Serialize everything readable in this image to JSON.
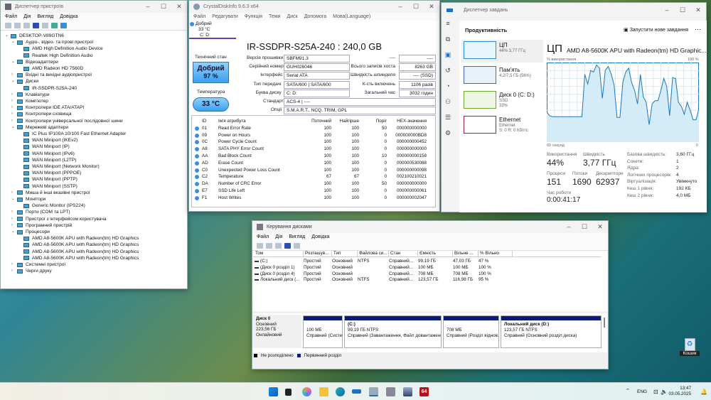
{
  "device_manager": {
    "title": "Диспетчер пристроїв",
    "menu": [
      "Файл",
      "Дія",
      "Вигляд",
      "Довідка"
    ],
    "tree": [
      {
        "l": 0,
        "t": "DESKTOP-V89GTN6",
        "e": "v"
      },
      {
        "l": 1,
        "t": "Аудіо-, відео- та ігрові пристрої",
        "e": "v"
      },
      {
        "l": 2,
        "t": "AMD High Definition Audio Device"
      },
      {
        "l": 2,
        "t": "Realtek High Definition Audio"
      },
      {
        "l": 1,
        "t": "Відеоадаптери",
        "e": "v"
      },
      {
        "l": 2,
        "t": "AMD Radeon HD 7560D"
      },
      {
        "l": 1,
        "t": "Вхідні та вихідні аудіопристрої",
        "e": ">"
      },
      {
        "l": 1,
        "t": "Диски",
        "e": "v"
      },
      {
        "l": 2,
        "t": "IR-SSDPR-S25A-240"
      },
      {
        "l": 1,
        "t": "Клавіатури",
        "e": ">"
      },
      {
        "l": 1,
        "t": "Комп'ютер",
        "e": ">"
      },
      {
        "l": 1,
        "t": "Контролери IDE ATA/ATAPI",
        "e": ">"
      },
      {
        "l": 1,
        "t": "Контролери сховища",
        "e": ">"
      },
      {
        "l": 1,
        "t": "Контролери універсальної послідовної шини",
        "e": ">"
      },
      {
        "l": 1,
        "t": "Мережеві адаптери",
        "e": "v"
      },
      {
        "l": 2,
        "t": "IC Plus IP100A 10/100 Fast Ethernet Adapter"
      },
      {
        "l": 2,
        "t": "WAN Miniport (IKEv2)"
      },
      {
        "l": 2,
        "t": "WAN Miniport (IP)"
      },
      {
        "l": 2,
        "t": "WAN Miniport (IPv6)"
      },
      {
        "l": 2,
        "t": "WAN Miniport (L2TP)"
      },
      {
        "l": 2,
        "t": "WAN Miniport (Network Monitor)"
      },
      {
        "l": 2,
        "t": "WAN Miniport (PPPOE)"
      },
      {
        "l": 2,
        "t": "WAN Miniport (PPTP)"
      },
      {
        "l": 2,
        "t": "WAN Miniport (SSTP)"
      },
      {
        "l": 1,
        "t": "Миша й інші вказівні пристрої",
        "e": ">"
      },
      {
        "l": 1,
        "t": "Монітори",
        "e": "v"
      },
      {
        "l": 2,
        "t": "Generic Monitor (IPS224)"
      },
      {
        "l": 1,
        "t": "Порти (COM та LPT)",
        "e": ">"
      },
      {
        "l": 1,
        "t": "Пристрої з інтерфейсом користувача",
        "e": ">"
      },
      {
        "l": 1,
        "t": "Програмний пристрій",
        "e": ">"
      },
      {
        "l": 1,
        "t": "Процесори",
        "e": "v"
      },
      {
        "l": 2,
        "t": "AMD A8-5600K APU with Radeon(tm) HD Graphics"
      },
      {
        "l": 2,
        "t": "AMD A8-5600K APU with Radeon(tm) HD Graphics"
      },
      {
        "l": 2,
        "t": "AMD A8-5600K APU with Radeon(tm) HD Graphics"
      },
      {
        "l": 2,
        "t": "AMD A8-5600K APU with Radeon(tm) HD Graphics"
      },
      {
        "l": 1,
        "t": "Системні пристрої",
        "e": ">"
      },
      {
        "l": 1,
        "t": "Черги друку",
        "e": ">"
      }
    ]
  },
  "crystal": {
    "title": "CrystalDiskInfo 9.6.3 x64",
    "menu": [
      "Файл",
      "Редагувати",
      "Функція",
      "Теми",
      "Диск",
      "Допомога",
      "Мова(Language)"
    ],
    "tab": {
      "status": "Добрий",
      "temp": "33 °C",
      "drives": "C: D:"
    },
    "model": "IR-SSDPR-S25A-240 : 240,0 GB",
    "health_label": "Технічний стан",
    "health_status": "Добрий",
    "health_pct": "97 %",
    "temp_label": "Температура",
    "temp": "33 °C",
    "fields_left": [
      {
        "k": "Версія прошивки",
        "v": "SBFM91.3"
      },
      {
        "k": "Серійний номер",
        "v": "GUH026046"
      },
      {
        "k": "Інтерфейс",
        "v": "Serial ATA"
      },
      {
        "k": "Тип передачі",
        "v": "SATA/600 | SATA/600"
      },
      {
        "k": "Буква диску",
        "v": "C: D:"
      }
    ],
    "fields_right": [
      {
        "k": "----",
        "v": "----"
      },
      {
        "k": "Всього записів хоста",
        "v": "8263 GB"
      },
      {
        "k": "Швидкість шпинделя",
        "v": "---- (SSD)"
      },
      {
        "k": "К-сть включень",
        "v": "1106 разів"
      },
      {
        "k": "Загальний час",
        "v": "3032 годин"
      }
    ],
    "standard_label": "Стандарт",
    "standard": "ACS-4 | ----",
    "features_label": "Опції",
    "features": "S.M.A.R.T., NCQ, TRIM, GPL",
    "smart_headers": [
      "ID",
      "Ім'я атрибута",
      "Поточний",
      "Найгірше",
      "Поріг",
      "HEX-значення"
    ],
    "smart": [
      [
        "01",
        "Read Error Rate",
        "100",
        "100",
        "50",
        "000000000000"
      ],
      [
        "09",
        "Power on Hours",
        "100",
        "100",
        "0",
        "000000000BD8"
      ],
      [
        "0C",
        "Power Cycle Count",
        "100",
        "100",
        "0",
        "000000000452"
      ],
      [
        "A8",
        "SATA PHY Error Count",
        "100",
        "100",
        "0",
        "000000000000"
      ],
      [
        "AA",
        "Bad Block Count",
        "100",
        "100",
        "10",
        "000000000158"
      ],
      [
        "AD",
        "Erase Count",
        "100",
        "100",
        "0",
        "000000530088"
      ],
      [
        "C0",
        "Unexpected Power Loss Count",
        "100",
        "100",
        "0",
        "000000000098"
      ],
      [
        "C2",
        "Temperature",
        "67",
        "67",
        "0",
        "002100210021"
      ],
      [
        "DA",
        "Number of CRC Error",
        "100",
        "100",
        "50",
        "000000000000"
      ],
      [
        "E7",
        "SSD Life Left",
        "100",
        "100",
        "0",
        "000000000061"
      ],
      [
        "F1",
        "Host Writes",
        "100",
        "100",
        "0",
        "000000002047"
      ]
    ]
  },
  "task_manager": {
    "title": "Диспетчер завдань",
    "section": "Продуктивність",
    "run_task": "Запустити нове завдання",
    "more": "⋯",
    "side": [
      {
        "name": "ЦП",
        "sub": "44% 3,77 ГГц"
      },
      {
        "name": "Пам'ять",
        "sub": "4,2/7,5 ГБ (56%)"
      },
      {
        "name": "Диск 0 (C: D:)",
        "sub": "SSD",
        "sub2": "33%"
      },
      {
        "name": "Ethernet",
        "sub": "Ethernet",
        "sub2": "S: 0 R: 0 Кбіт/с"
      }
    ],
    "cpu_title": "ЦП",
    "cpu_name": "AMD A8-5600K APU with Radeon(tm) HD Graphic...",
    "usage_label": "% використання",
    "max": "100 %",
    "time_label": "60 секунд",
    "min": "0",
    "cpu_history": [
      38,
      33,
      32,
      32,
      32,
      32,
      32,
      32,
      32,
      32,
      32,
      32,
      32,
      85,
      73,
      90,
      88,
      97,
      93,
      55,
      90,
      95,
      86,
      72,
      31,
      31,
      75,
      88,
      93,
      75,
      65,
      48,
      85,
      57,
      50,
      22,
      48,
      52,
      52,
      65,
      80,
      70,
      33,
      81,
      80,
      50,
      45,
      35,
      50,
      40,
      28,
      28,
      42
    ],
    "stats": {
      "util_label": "Використання",
      "util": "44%",
      "speed_label": "Швидкість",
      "speed": "3,77 ГГц",
      "proc_label": "Процеси",
      "proc": "151",
      "threads_label": "Потоки",
      "threads": "1690",
      "handles_label": "Дескриптори",
      "handles": "62937",
      "uptime_label": "Час роботи",
      "uptime": "0:00:41:17"
    },
    "specs": [
      [
        "Базова швидкість:",
        "3,60 ГГц"
      ],
      [
        "Сокети:",
        "1"
      ],
      [
        "Ядра:",
        "2"
      ],
      [
        "Логічних процесорів:",
        "4"
      ],
      [
        "Віртуалізація:",
        "Увімкнуто"
      ],
      [
        "Кеш 1 рівня:",
        "192 КБ"
      ],
      [
        "Кеш 2 рівня:",
        "4,0 МБ"
      ]
    ]
  },
  "disk_mgmt": {
    "title": "Керування дисками",
    "menu": [
      "Файл",
      "Дія",
      "Вигляд",
      "Довідка"
    ],
    "headers": [
      "Том",
      "Розташув...",
      "Тип",
      "Файлова си...",
      "Стан",
      "Ємність",
      "Вільне ...",
      "% Вільно"
    ],
    "volumes": [
      [
        "(C:)",
        "Простий",
        "Основний",
        "NTFS",
        "Справний...",
        "99,19 ГБ",
        "47,03 ГБ",
        "47 %"
      ],
      [
        "(Диск 0 розділ 1)",
        "Простий",
        "Основний",
        "",
        "Справний...",
        "100 МБ",
        "100 МБ",
        "100 %"
      ],
      [
        "(Диск 0 розділ 4)",
        "Простий",
        "Основний",
        "",
        "Справний...",
        "708 МБ",
        "708 МБ",
        "100 %"
      ],
      [
        "Локальний диск (...",
        "Простий",
        "Основний",
        "NTFS",
        "Справний...",
        "123,57 ГБ",
        "116,98 ГБ",
        "95 %"
      ]
    ],
    "disk": {
      "name": "Диск 0",
      "type": "Основний",
      "size": "223,56 ГБ",
      "status": "Онлайновий"
    },
    "partitions": [
      {
        "l1": "",
        "l2": "100 МБ",
        "l3": "Справний (Систе"
      },
      {
        "l1": "(C:)",
        "l2": "99,19 ГБ NTFS",
        "l3": "Справний (Завантаження, Файл довантаження"
      },
      {
        "l1": "",
        "l2": "708 МБ",
        "l3": "Справний (Розділ віднов."
      },
      {
        "l1": "Локальний диск  (D:)",
        "l2": "123,57 ГБ NTFS",
        "l3": "Справний (Основний розділ диска)"
      }
    ],
    "legend": [
      "Не розподілено",
      "Первинний розділ"
    ],
    "colors": {
      "unallocated": "#000000",
      "primary": "#0a1a7a"
    }
  },
  "desktop": {
    "recycle_bin": "Кошик"
  },
  "taskbar": {
    "lang": "ENG",
    "time": "13:47",
    "date": "03.05.2025",
    "aida": "64"
  }
}
